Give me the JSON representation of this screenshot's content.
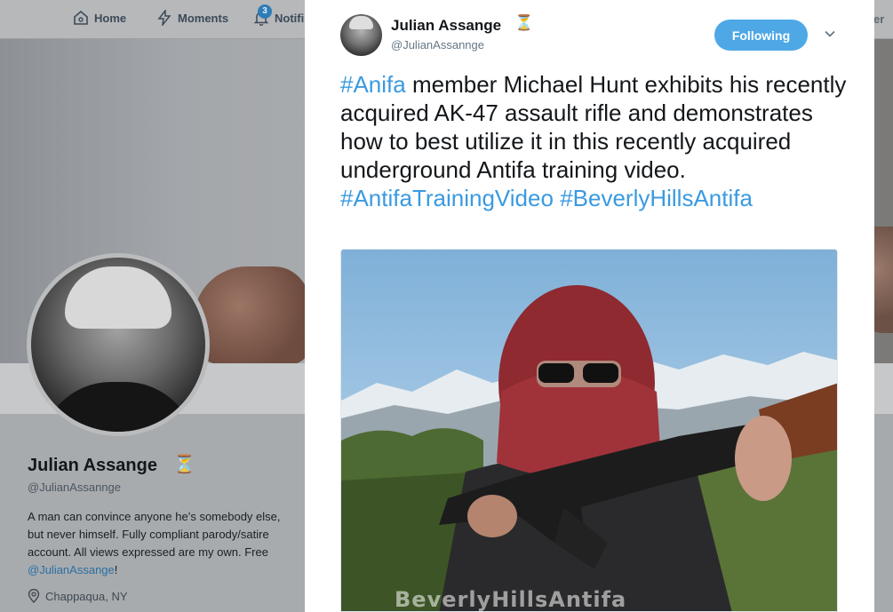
{
  "nav": {
    "home_label": "Home",
    "moments_label": "Moments",
    "notifications_label": "Notifi",
    "notifications_count": "3",
    "right_fragment": "er"
  },
  "profile": {
    "name": "Julian Assange",
    "name_icon": "hourglass-icon",
    "handle": "@JulianAssannge",
    "bio_text": "A man can convince anyone he’s somebody else, but never himself. Fully compliant parody/satire account. All views expressed are my own. Free ",
    "bio_link": "@JulianAssange",
    "bio_end": "!",
    "location": "Chappaqua, NY"
  },
  "tweet": {
    "author_name": "Julian Assange",
    "author_icon": "hourglass-icon",
    "author_handle": "@JulianAssannge",
    "follow_label": "Following",
    "tag1": "#Anifa",
    "text": " member Michael Hunt exhibits his recently acquired AK-47 assault rifle and demonstrates how to best utilize it in this recently acquired underground Antifa training video. ",
    "tag2": "#AntifaTrainingVideo",
    "tag3": "#BeverlyHillsAntifa",
    "media_watermark": "BeverlyHillsAntifa"
  },
  "colors": {
    "link": "#3a9ae0",
    "follow_button": "#4ea8e6",
    "hourglass": "#b88a2d"
  }
}
